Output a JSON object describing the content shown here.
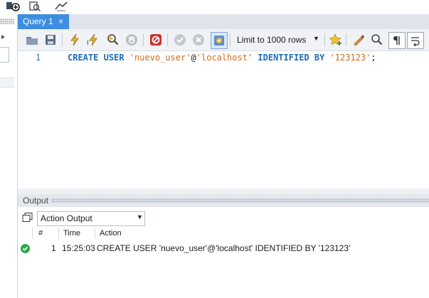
{
  "tabs": [
    {
      "label": "Query 1",
      "close": "×"
    }
  ],
  "toolbar": {
    "icons": [
      "open-folder-icon",
      "save-icon",
      "execute-icon",
      "execute-current-icon",
      "explain-icon",
      "stop-icon",
      "toggle-errors-icon",
      "commit-icon",
      "rollback-icon",
      "autocommit-icon",
      "bookmark-icon",
      "beautify-icon",
      "find-icon",
      "invisible-chars-icon",
      "wrap-icon"
    ],
    "limit_select": {
      "value": "Limit to 1000 rows"
    }
  },
  "editor": {
    "line_number": "1",
    "tokens": {
      "k1": "CREATE",
      "k2": "USER",
      "s1": "'nuevo_user'",
      "at": "@",
      "s2": "'localhost'",
      "k3": "IDENTIFIED",
      "k4": "BY",
      "s3": "'123123'",
      "semi": ";"
    }
  },
  "output": {
    "title": "Output",
    "select_value": "Action Output",
    "columns": {
      "num": "#",
      "time": "Time",
      "action": "Action"
    },
    "rows": [
      {
        "status": "success",
        "num": "1",
        "time": "15:25:03",
        "action": "CREATE USER 'nuevo_user'@'localhost' IDENTIFIED BY '123123'"
      }
    ]
  },
  "colors": {
    "tab_active": "#3d8ee0",
    "keyword": "#1d6cb8",
    "string": "#d06d1a",
    "success": "#2da84a"
  }
}
